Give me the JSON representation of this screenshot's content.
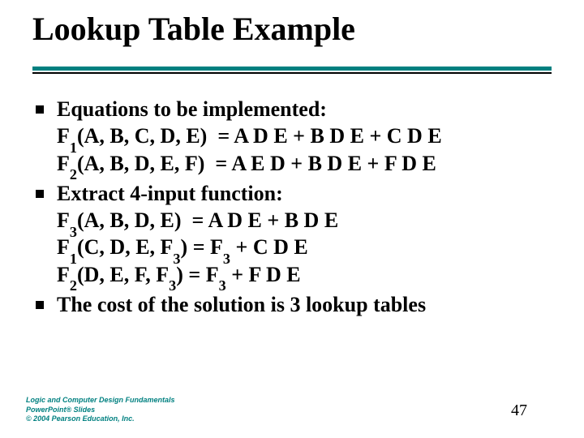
{
  "title": "Lookup Table Example",
  "bullets": [
    {
      "lead": "Equations to be implemented:",
      "lines": [
        {
          "fn": "F",
          "sub": "1",
          "args": "(A, B, C, D, E)",
          "rhs": "A D E + B D E + C D E"
        },
        {
          "fn": "F",
          "sub": "2",
          "args": "(A, B, D, E, F)",
          "rhs": "A E D + B D E + F D E"
        }
      ]
    },
    {
      "lead": "Extract 4-input function:",
      "lines": [
        {
          "fn": "F",
          "sub": "3",
          "args": "(A, B, D, E)",
          "rhs": "A D E + B D E"
        },
        {
          "fn": "F",
          "sub": "1",
          "args": "(C, D, E, F",
          "arg_sub": "3",
          "args_close": ")",
          "rhs_pre": "F",
          "rhs_sub": "3",
          "rhs_rest": " + C D E"
        },
        {
          "fn": "F",
          "sub": "2",
          "args": "(D, E, F, F",
          "arg_sub": "3",
          "args_close": ")",
          "rhs_pre": "F",
          "rhs_sub": "3",
          "rhs_rest": " + F D E"
        }
      ]
    },
    {
      "lead": "The cost of the solution is 3 lookup tables",
      "lines": []
    }
  ],
  "footer": {
    "l1": "Logic and Computer Design Fundamentals",
    "l2": "PowerPoint® Slides",
    "l3": "© 2004 Pearson Education, Inc."
  },
  "page": "47"
}
